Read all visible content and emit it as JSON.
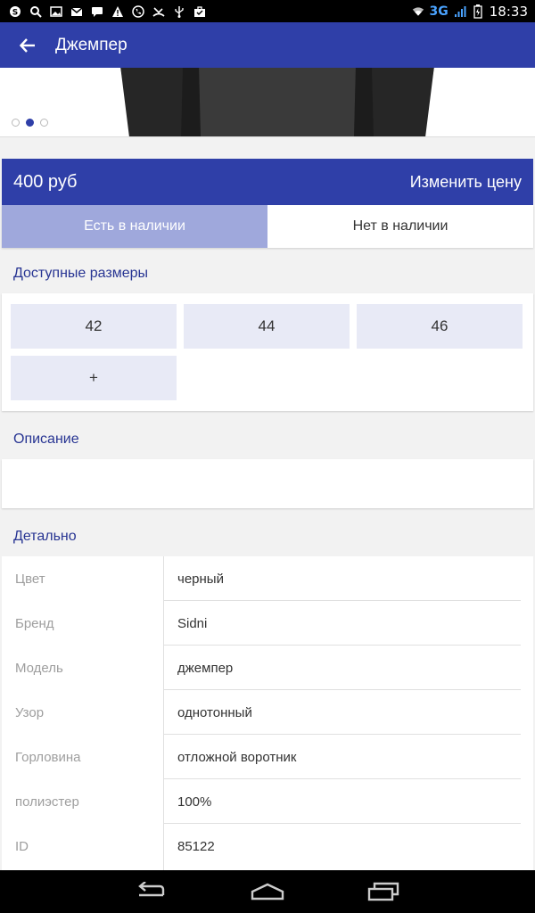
{
  "status_bar": {
    "network": "3G",
    "time": "18:33",
    "left_icons": [
      "skype-icon",
      "search-icon",
      "image-icon",
      "gmail-icon",
      "chat-icon",
      "warning-icon",
      "viber-icon",
      "missed-call-icon",
      "usb-icon",
      "briefcase-icon"
    ]
  },
  "app_bar": {
    "title": "Джемпер"
  },
  "gallery": {
    "count": 3,
    "active_index": 1
  },
  "price": {
    "value": "400 руб",
    "change_label": "Изменить цену"
  },
  "stock": {
    "in_stock": "Есть в наличии",
    "out_of_stock": "Нет в наличии",
    "selected": "in_stock"
  },
  "sizes": {
    "title": "Доступные размеры",
    "items": [
      "42",
      "44",
      "46"
    ],
    "add_label": "+"
  },
  "description": {
    "title": "Описание",
    "text": ""
  },
  "details": {
    "title": "Детально",
    "rows": [
      {
        "key": "Цвет",
        "value": "черный"
      },
      {
        "key": "Бренд",
        "value": "Sidni"
      },
      {
        "key": "Модель",
        "value": "джемпер"
      },
      {
        "key": "Узор",
        "value": "однотонный"
      },
      {
        "key": "Горловина",
        "value": "отложной воротник"
      },
      {
        "key": "полиэстер",
        "value": "100%"
      },
      {
        "key": "ID",
        "value": "85122"
      }
    ]
  },
  "colors": {
    "primary": "#2f3fa8",
    "toggle_selected": "#9fa8dc",
    "chip_bg": "#e8eaf6",
    "section_title": "#283593"
  }
}
